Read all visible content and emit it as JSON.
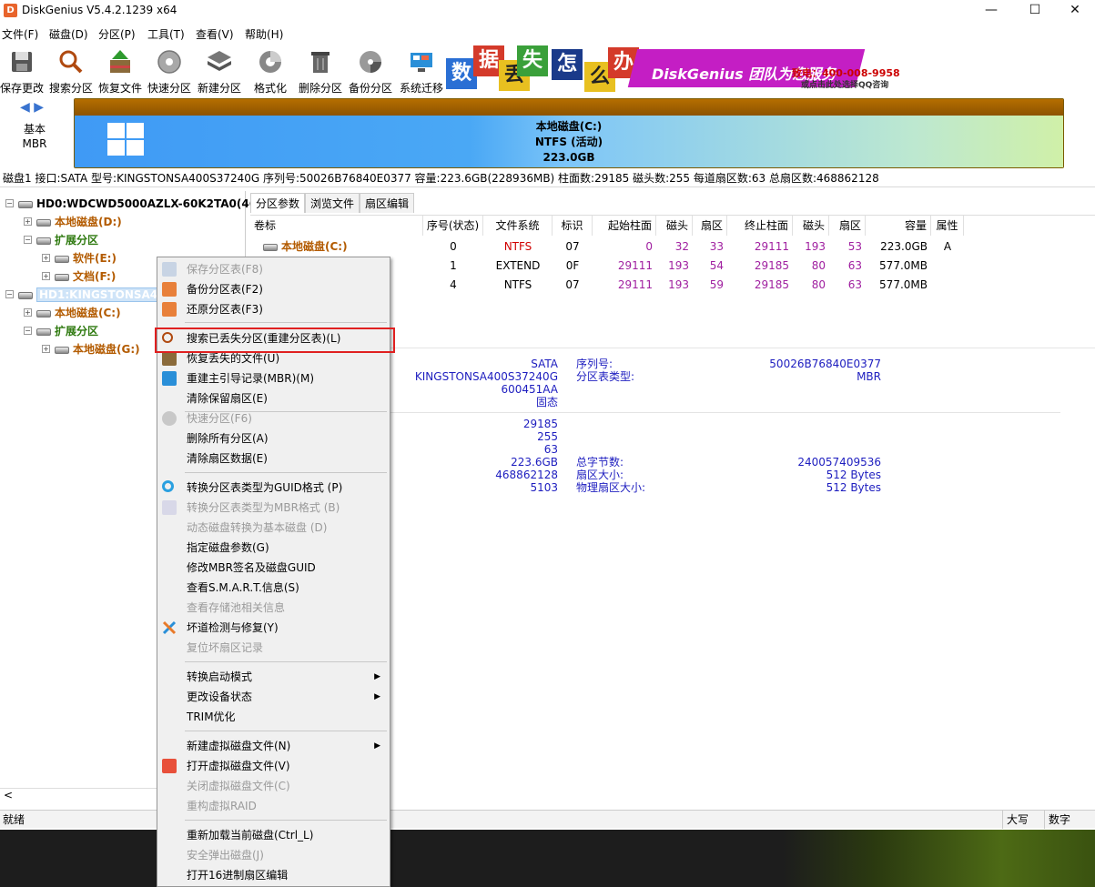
{
  "window": {
    "title": "DiskGenius V5.4.2.1239 x64",
    "app_icon": "D",
    "min_glyph": "—",
    "max_glyph": "☐",
    "close_glyph": "✕"
  },
  "menubar": [
    "文件(F)",
    "磁盘(D)",
    "分区(P)",
    "工具(T)",
    "查看(V)",
    "帮助(H)"
  ],
  "toolbar": [
    "保存更改",
    "搜索分区",
    "恢复文件",
    "快速分区",
    "新建分区",
    "格式化",
    "删除分区",
    "备份分区",
    "系统迁移"
  ],
  "banner": {
    "chars": [
      "数",
      "据",
      "丢",
      "失",
      "怎",
      "么",
      "办"
    ],
    "slogan": "DiskGenius 团队为您服务",
    "phone": "致电：400-008-9958",
    "qq": "或点击此处选择QQ咨询"
  },
  "diskmap": {
    "nav_arrows": "◀ ▶",
    "type_line1": "基本",
    "type_line2": "MBR",
    "partition_name": "本地磁盘(C:)",
    "partition_fs": "NTFS (活动)",
    "partition_size": "223.0GB"
  },
  "disk_info": "磁盘1 接口:SATA  型号:KINGSTONSA400S37240G  序列号:50026B76840E0377  容量:223.6GB(228936MB)  柱面数:29185  磁头数:255  每道扇区数:63  总扇区数:468862128",
  "tree": {
    "hd0": "HD0:WDCWD5000AZLX-60K2TA0(46",
    "hd0_d": "本地磁盘(D:)",
    "hd0_ext": "扩展分区",
    "hd0_e": "软件(E:)",
    "hd0_f": "文档(F:)",
    "hd1": "HD1:KINGSTONSA400",
    "hd1_c": "本地磁盘(C:)",
    "hd1_ext": "扩展分区",
    "hd1_g": "本地磁盘(G:)",
    "exp_minus": "−",
    "exp_plus": "+",
    "scroll_left": "<"
  },
  "tabs": [
    "分区参数",
    "浏览文件",
    "扇区编辑"
  ],
  "table": {
    "headers": [
      "卷标",
      "序号(状态)",
      "文件系统",
      "标识",
      "起始柱面",
      "磁头",
      "扇区",
      "终止柱面",
      "磁头",
      "扇区",
      "容量",
      "属性"
    ],
    "rows": [
      [
        "本地磁盘(C:)",
        "0",
        "NTFS",
        "07",
        "0",
        "32",
        "33",
        "29111",
        "193",
        "53",
        "223.0GB",
        "A"
      ],
      [
        "",
        "1",
        "EXTEND",
        "0F",
        "29111",
        "193",
        "54",
        "29185",
        "80",
        "63",
        "577.0MB",
        ""
      ],
      [
        "",
        "4",
        "NTFS",
        "07",
        "29111",
        "193",
        "59",
        "29185",
        "80",
        "63",
        "577.0MB",
        ""
      ]
    ]
  },
  "details": {
    "col1": [
      "SATA",
      "KINGSTONSA400S37240G",
      "600451AA",
      "固态"
    ],
    "col1_lower": [
      "29185",
      "255",
      "63",
      "223.6GB",
      "468862128",
      "5103"
    ],
    "labels_top": [
      "序列号:",
      "分区表类型:"
    ],
    "values_top": [
      "50026B76840E0377",
      "MBR"
    ],
    "labels_bottom": [
      "总字节数:",
      "扇区大小:",
      "物理扇区大小:"
    ],
    "values_bottom": [
      "240057409536",
      "512 Bytes",
      "512 Bytes"
    ]
  },
  "status": {
    "left": "就绪",
    "caps": "大写",
    "num": "数字"
  },
  "context_menu": {
    "items": [
      {
        "label": "保存分区表(F8)",
        "disabled": true
      },
      {
        "label": "备份分区表(F2)",
        "disabled": false
      },
      {
        "label": "还原分区表(F3)",
        "disabled": false
      },
      {
        "label": "搜索已丢失分区(重建分区表)(L)",
        "disabled": false
      },
      {
        "label": "恢复丢失的文件(U)",
        "disabled": false
      },
      {
        "label": "重建主引导记录(MBR)(M)",
        "disabled": false
      },
      {
        "label": "清除保留扇区(E)",
        "disabled": false
      },
      {
        "label": "快速分区(F6)",
        "disabled": true
      },
      {
        "label": "删除所有分区(A)",
        "disabled": false
      },
      {
        "label": "清除扇区数据(E)",
        "disabled": false
      },
      {
        "label": "转换分区表类型为GUID格式 (P)",
        "disabled": false
      },
      {
        "label": "转换分区表类型为MBR格式 (B)",
        "disabled": true
      },
      {
        "label": "动态磁盘转换为基本磁盘 (D)",
        "disabled": true
      },
      {
        "label": "指定磁盘参数(G)",
        "disabled": false
      },
      {
        "label": "修改MBR签名及磁盘GUID",
        "disabled": false
      },
      {
        "label": "查看S.M.A.R.T.信息(S)",
        "disabled": false
      },
      {
        "label": "查看存储池相关信息",
        "disabled": true
      },
      {
        "label": "坏道检测与修复(Y)",
        "disabled": false
      },
      {
        "label": "复位坏扇区记录",
        "disabled": true
      },
      {
        "label": "转换启动模式",
        "disabled": false
      },
      {
        "label": "更改设备状态",
        "disabled": false
      },
      {
        "label": "TRIM优化",
        "disabled": false
      },
      {
        "label": "新建虚拟磁盘文件(N)",
        "disabled": false
      },
      {
        "label": "打开虚拟磁盘文件(V)",
        "disabled": false
      },
      {
        "label": "关闭虚拟磁盘文件(C)",
        "disabled": true
      },
      {
        "label": "重构虚拟RAID",
        "disabled": true
      },
      {
        "label": "重新加载当前磁盘(Ctrl_L)",
        "disabled": false
      },
      {
        "label": "安全弹出磁盘(J)",
        "disabled": true
      },
      {
        "label": "打开16进制扇区编辑",
        "disabled": false
      }
    ],
    "submenu_arrow": "▶"
  },
  "colors": {
    "accent_blue": "#1d1dbf",
    "red_fs": "#d00000",
    "purple_val": "#a020a0",
    "highlight_box": "#e02020"
  }
}
